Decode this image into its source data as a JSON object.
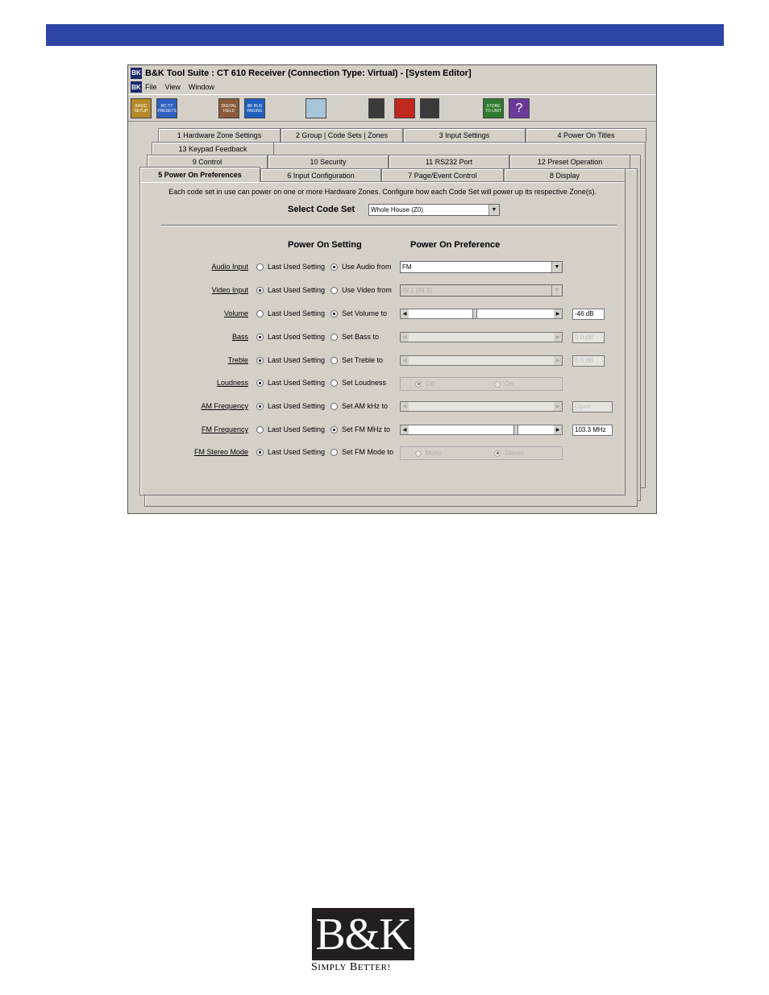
{
  "window": {
    "icon_text": "BK",
    "title": "B&K Tool Suite : CT 610 Receiver (Connection Type: Virtual) - [System Editor]"
  },
  "menu": [
    "File",
    "View",
    "Window"
  ],
  "toolbar": [
    {
      "label": "BASIC SETUP",
      "color": "#b5892a"
    },
    {
      "label": "RC-TT PRESETS",
      "color": "#2f5fbf"
    },
    {
      "label": "DIGITAL FIELD",
      "color": "#8a5a3a"
    },
    {
      "label": "BK BUS PAGING",
      "color": "#1f5fbf"
    },
    {
      "label": "",
      "color": "#a7c4d8"
    },
    {
      "label": "",
      "color": "#3a3a3a"
    },
    {
      "label": "",
      "color": "#c0281e"
    },
    {
      "label": "",
      "color": "#3a3a3a"
    },
    {
      "label": "STORE TO UNIT",
      "color": "#2f7a2f"
    },
    {
      "label": "?",
      "color": "#6a3a9a"
    }
  ],
  "tabs": {
    "row1": [
      "1   Hardware Zone Settings",
      "2  Group | Code Sets | Zones",
      "3   Input Settings",
      "4   Power On Titles"
    ],
    "row2": [
      "13 Keypad Feedback"
    ],
    "row3": [
      "9   Control",
      "10   Security",
      "11   RS232 Port",
      "12   Preset Operation"
    ],
    "row4": [
      "5   Power On Preferences",
      "6   Input Configuration",
      "7   Page/Event Control",
      "8   Display"
    ]
  },
  "panel": {
    "intro": "Each code set in use can power on one or more Hardware Zones. Configure how each Code Set will power up its respective Zone(s).",
    "select_code_set_label": "Select Code Set",
    "select_code_set_value": "Whole House (Z0)",
    "col_setting": "Power On Setting",
    "col_preference": "Power On Preference",
    "last_used": "Last Used Setting",
    "rows": [
      {
        "label": "Audio Input",
        "alt": "Use Audio from",
        "last_used_selected": false,
        "value": "FM"
      },
      {
        "label": "Video Input",
        "alt": "Use Video from",
        "last_used_selected": true,
        "value": "IN 1 (IN 1)"
      },
      {
        "label": "Volume",
        "alt": "Set Volume to",
        "last_used_selected": false,
        "value": "-46 dB"
      },
      {
        "label": "Bass",
        "alt": "Set Bass to",
        "last_used_selected": true,
        "value": "0.0 dB"
      },
      {
        "label": "Treble",
        "alt": "Set Treble to",
        "last_used_selected": true,
        "value": "0.0 dB"
      },
      {
        "label": "Loudness",
        "alt": "Set Loudness",
        "last_used_selected": true,
        "options": [
          "Off",
          "On"
        ]
      },
      {
        "label": "AM Frequency",
        "alt": "Set AM kHz to",
        "last_used_selected": true,
        "value": "Open"
      },
      {
        "label": "FM Frequency",
        "alt": "Set FM MHz to",
        "last_used_selected": false,
        "value": "103.3 MHz"
      },
      {
        "label": "FM Stereo Mode",
        "alt": "Set FM Mode to",
        "last_used_selected": true,
        "options": [
          "Mono",
          "Stereo"
        ]
      }
    ],
    "volume_level": 0.45,
    "fm_level": 0.74
  },
  "logo": {
    "text": "B&K",
    "tagline": "Simply Better!"
  }
}
